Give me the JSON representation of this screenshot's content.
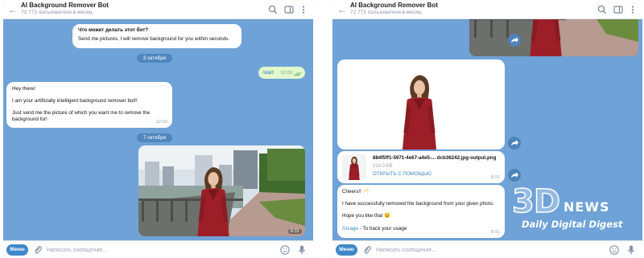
{
  "left": {
    "header": {
      "title": "AI Background Remover Bot",
      "subtitle": "72 773 пользователя в месяц"
    },
    "bot_info": {
      "title": "Что может делать этот бот?",
      "body": "Send me pictures, I will remove background for you within seconds."
    },
    "date1": "3 октября",
    "start_msg": {
      "text": "/start",
      "time": "12:00"
    },
    "welcome": {
      "line1": "Hey there!",
      "line2": "I am your artificially intelligent background remover bot!!",
      "line3": "Just send me the picture of which you want me to remove the background for!",
      "time": "12:00"
    },
    "date2": "7 октября",
    "photo_time": "8:31",
    "footer": {
      "menu": "Меню",
      "placeholder": "Написать сообщение..."
    }
  },
  "right": {
    "header": {
      "title": "AI Background Remover Bot",
      "subtitle": "72 773 пользователя в месяц"
    },
    "file": {
      "name": "884f5ff1-5971-4e67-a4e5-... dcb36242.jpg-output.png",
      "size": "214.0 KB",
      "open": "ОТКРЫТЬ С ПОМОЩЬЮ",
      "time": "8:31"
    },
    "done": {
      "line1": "Cheers!! 🥂",
      "line2": "I have successfully removed the background from your given photo.",
      "line3": "Hope you like that 😉",
      "cmd": "/Usage",
      "cmd_rest": " - To track your usage",
      "time": "8:31"
    },
    "footer": {
      "menu": "Меню",
      "placeholder": "Написать сообщение..."
    }
  },
  "watermark": {
    "brand": "3D",
    "news": "NEWS",
    "tagline": "Daily Digital Digest"
  },
  "colors": {
    "chat_bg": "#6fa2d6",
    "accent": "#3e88c8",
    "outgoing": "#e2f7cd",
    "date_pill": "#4f87bd"
  },
  "icons": [
    "back-arrow-icon",
    "search-icon",
    "sidebar-icon",
    "more-icon",
    "paperclip-icon",
    "emoji-icon",
    "microphone-icon",
    "share-icon",
    "double-check-icon"
  ]
}
